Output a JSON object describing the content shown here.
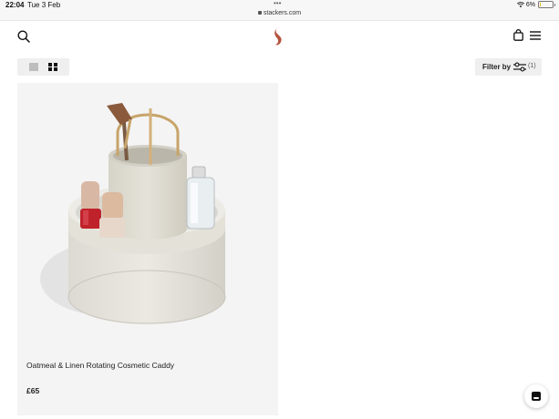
{
  "status_bar": {
    "time": "22:04",
    "date": "Tue 3 Feb",
    "dots": "•••",
    "url": "stackers.com",
    "battery": "6%",
    "battery_level": 0.06
  },
  "header": {
    "search_icon": "search-icon",
    "logo_icon": "stackers-logo",
    "bag_icon": "shopping-bag-icon",
    "menu_icon": "hamburger-menu-icon",
    "logo_color": "#b5543f"
  },
  "toolbar": {
    "filter_label": "Filter by",
    "filter_count": "(1)"
  },
  "products": [
    {
      "name": "Oatmeal & Linen Rotating Cosmetic Caddy",
      "price": "£65"
    }
  ],
  "chat": {
    "icon": "chat-icon"
  }
}
